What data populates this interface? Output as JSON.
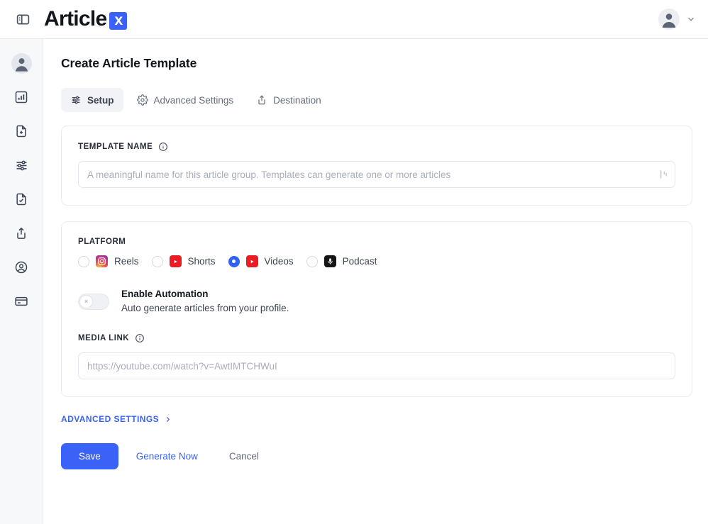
{
  "topbar": {
    "panel_toggle_icon": "sidebar-panel-icon",
    "brand_name": "Article",
    "brand_badge": "x",
    "account_chevron_icon": "chevron-down-icon",
    "avatar_icon": "user-avatar-icon"
  },
  "sidebar": {
    "items": [
      {
        "icon": "user-avatar-icon",
        "name": "profile"
      },
      {
        "icon": "bar-chart-icon",
        "name": "analytics"
      },
      {
        "icon": "file-plus-icon",
        "name": "new-document"
      },
      {
        "icon": "sliders-icon",
        "name": "settings"
      },
      {
        "icon": "file-check-icon",
        "name": "approved-documents"
      },
      {
        "icon": "share-upload-icon",
        "name": "publish"
      },
      {
        "icon": "user-circle-icon",
        "name": "account"
      },
      {
        "icon": "credit-card-icon",
        "name": "billing"
      }
    ]
  },
  "page": {
    "title": "Create Article Template"
  },
  "tabs": [
    {
      "label": "Setup",
      "icon": "sliders-icon",
      "active": true
    },
    {
      "label": "Advanced Settings",
      "icon": "gear-icon",
      "active": false
    },
    {
      "label": "Destination",
      "icon": "share-upload-icon",
      "active": false
    }
  ],
  "template_name": {
    "label": "TEMPLATE NAME",
    "info_icon": "info-icon",
    "value": "",
    "placeholder": "A meaningful name for this article group. Templates can generate one or more articles",
    "affix_icon": "text-cursor-icon"
  },
  "platform": {
    "label": "PLATFORM",
    "options": [
      {
        "label": "Reels",
        "icon": "instagram-icon",
        "selected": false
      },
      {
        "label": "Shorts",
        "icon": "youtube-icon",
        "selected": false
      },
      {
        "label": "Videos",
        "icon": "youtube-icon",
        "selected": true
      },
      {
        "label": "Podcast",
        "icon": "apple-podcast-icon",
        "selected": false
      }
    ]
  },
  "automation": {
    "title": "Enable Automation",
    "description": "Auto generate articles from your profile.",
    "enabled": false,
    "knob_glyph": "×"
  },
  "media_link": {
    "label": "MEDIA LINK",
    "info_icon": "info-icon",
    "value": "",
    "placeholder": "https://youtube.com/watch?v=AwtIMTCHWuI"
  },
  "advanced_settings_link": {
    "label": "ADVANCED SETTINGS",
    "chevron_icon": "chevron-right-icon"
  },
  "actions": {
    "save_label": "Save",
    "generate_label": "Generate Now",
    "cancel_label": "Cancel"
  },
  "colors": {
    "accent": "#3b62f6",
    "radio_selected": "#2f62f4",
    "youtube_red": "#ec1c24",
    "podcast_black": "#151515",
    "sidebar_bg": "#f7f8fa",
    "border": "#e9ebef"
  }
}
